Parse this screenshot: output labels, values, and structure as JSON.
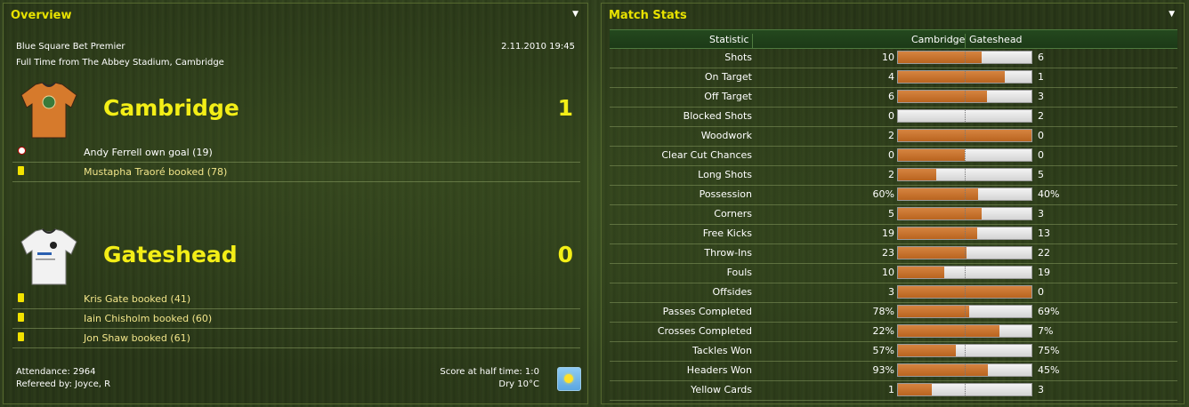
{
  "overview": {
    "title": "Overview",
    "competition": "Blue Square Bet Premier",
    "datetime": "2.11.2010 19:45",
    "result_line": "Full Time from The Abbey Stadium, Cambridge",
    "home": {
      "name": "Cambridge",
      "score": "1",
      "kit_colors": {
        "body": "#d67a2c",
        "trim": "#2b2b2b",
        "badge": "#3a7a3a"
      },
      "events": [
        {
          "icon": "goal-icon",
          "text": "Andy Ferrell own goal (19)",
          "color": "#ffffff"
        },
        {
          "icon": "yellow-card-icon",
          "text": "Mustapha Traoré booked (78)",
          "color": "#f2e58a"
        }
      ]
    },
    "away": {
      "name": "Gateshead",
      "score": "0",
      "kit_colors": {
        "body": "#f2f2f2",
        "trim": "#2b2b2b",
        "badge": "#222222"
      },
      "events": [
        {
          "icon": "yellow-card-icon",
          "text": "Kris Gate booked (41)",
          "color": "#f2e58a"
        },
        {
          "icon": "yellow-card-icon",
          "text": "Iain Chisholm booked (60)",
          "color": "#f2e58a"
        },
        {
          "icon": "yellow-card-icon",
          "text": "Jon Shaw booked (61)",
          "color": "#f2e58a"
        }
      ]
    },
    "attendance": "Attendance: 2964",
    "referee": "Refereed by: Joyce, R",
    "half_time": "Score at half time: 1:0",
    "weather": "Dry 10°C",
    "weather_icon": "sun-icon"
  },
  "stats": {
    "title": "Match Stats",
    "columns": {
      "statistic": "Statistic",
      "home": "Cambridge",
      "away": "Gateshead"
    },
    "colors": {
      "home_bar": "#c8732e",
      "away_bar": "#e6e6e6"
    },
    "rows": [
      {
        "label": "Shots",
        "home": "10",
        "away": "6",
        "home_share": 0.625
      },
      {
        "label": "On Target",
        "home": "4",
        "away": "1",
        "home_share": 0.8
      },
      {
        "label": "Off Target",
        "home": "6",
        "away": "3",
        "home_share": 0.667
      },
      {
        "label": "Blocked Shots",
        "home": "0",
        "away": "2",
        "home_share": 0
      },
      {
        "label": "Woodwork",
        "home": "2",
        "away": "0",
        "home_share": 1
      },
      {
        "label": "Clear Cut Chances",
        "home": "0",
        "away": "0",
        "home_share": 0.5
      },
      {
        "label": "Long Shots",
        "home": "2",
        "away": "5",
        "home_share": 0.286
      },
      {
        "label": "Possession",
        "home": "60%",
        "away": "40%",
        "home_share": 0.6
      },
      {
        "label": "Corners",
        "home": "5",
        "away": "3",
        "home_share": 0.625
      },
      {
        "label": "Free Kicks",
        "home": "19",
        "away": "13",
        "home_share": 0.594
      },
      {
        "label": "Throw-Ins",
        "home": "23",
        "away": "22",
        "home_share": 0.511
      },
      {
        "label": "Fouls",
        "home": "10",
        "away": "19",
        "home_share": 0.345
      },
      {
        "label": "Offsides",
        "home": "3",
        "away": "0",
        "home_share": 1
      },
      {
        "label": "Passes Completed",
        "home": "78%",
        "away": "69%",
        "home_share": 0.531
      },
      {
        "label": "Crosses Completed",
        "home": "22%",
        "away": "7%",
        "home_share": 0.759
      },
      {
        "label": "Tackles Won",
        "home": "57%",
        "away": "75%",
        "home_share": 0.432
      },
      {
        "label": "Headers Won",
        "home": "93%",
        "away": "45%",
        "home_share": 0.674
      },
      {
        "label": "Yellow Cards",
        "home": "1",
        "away": "3",
        "home_share": 0.25
      }
    ]
  }
}
